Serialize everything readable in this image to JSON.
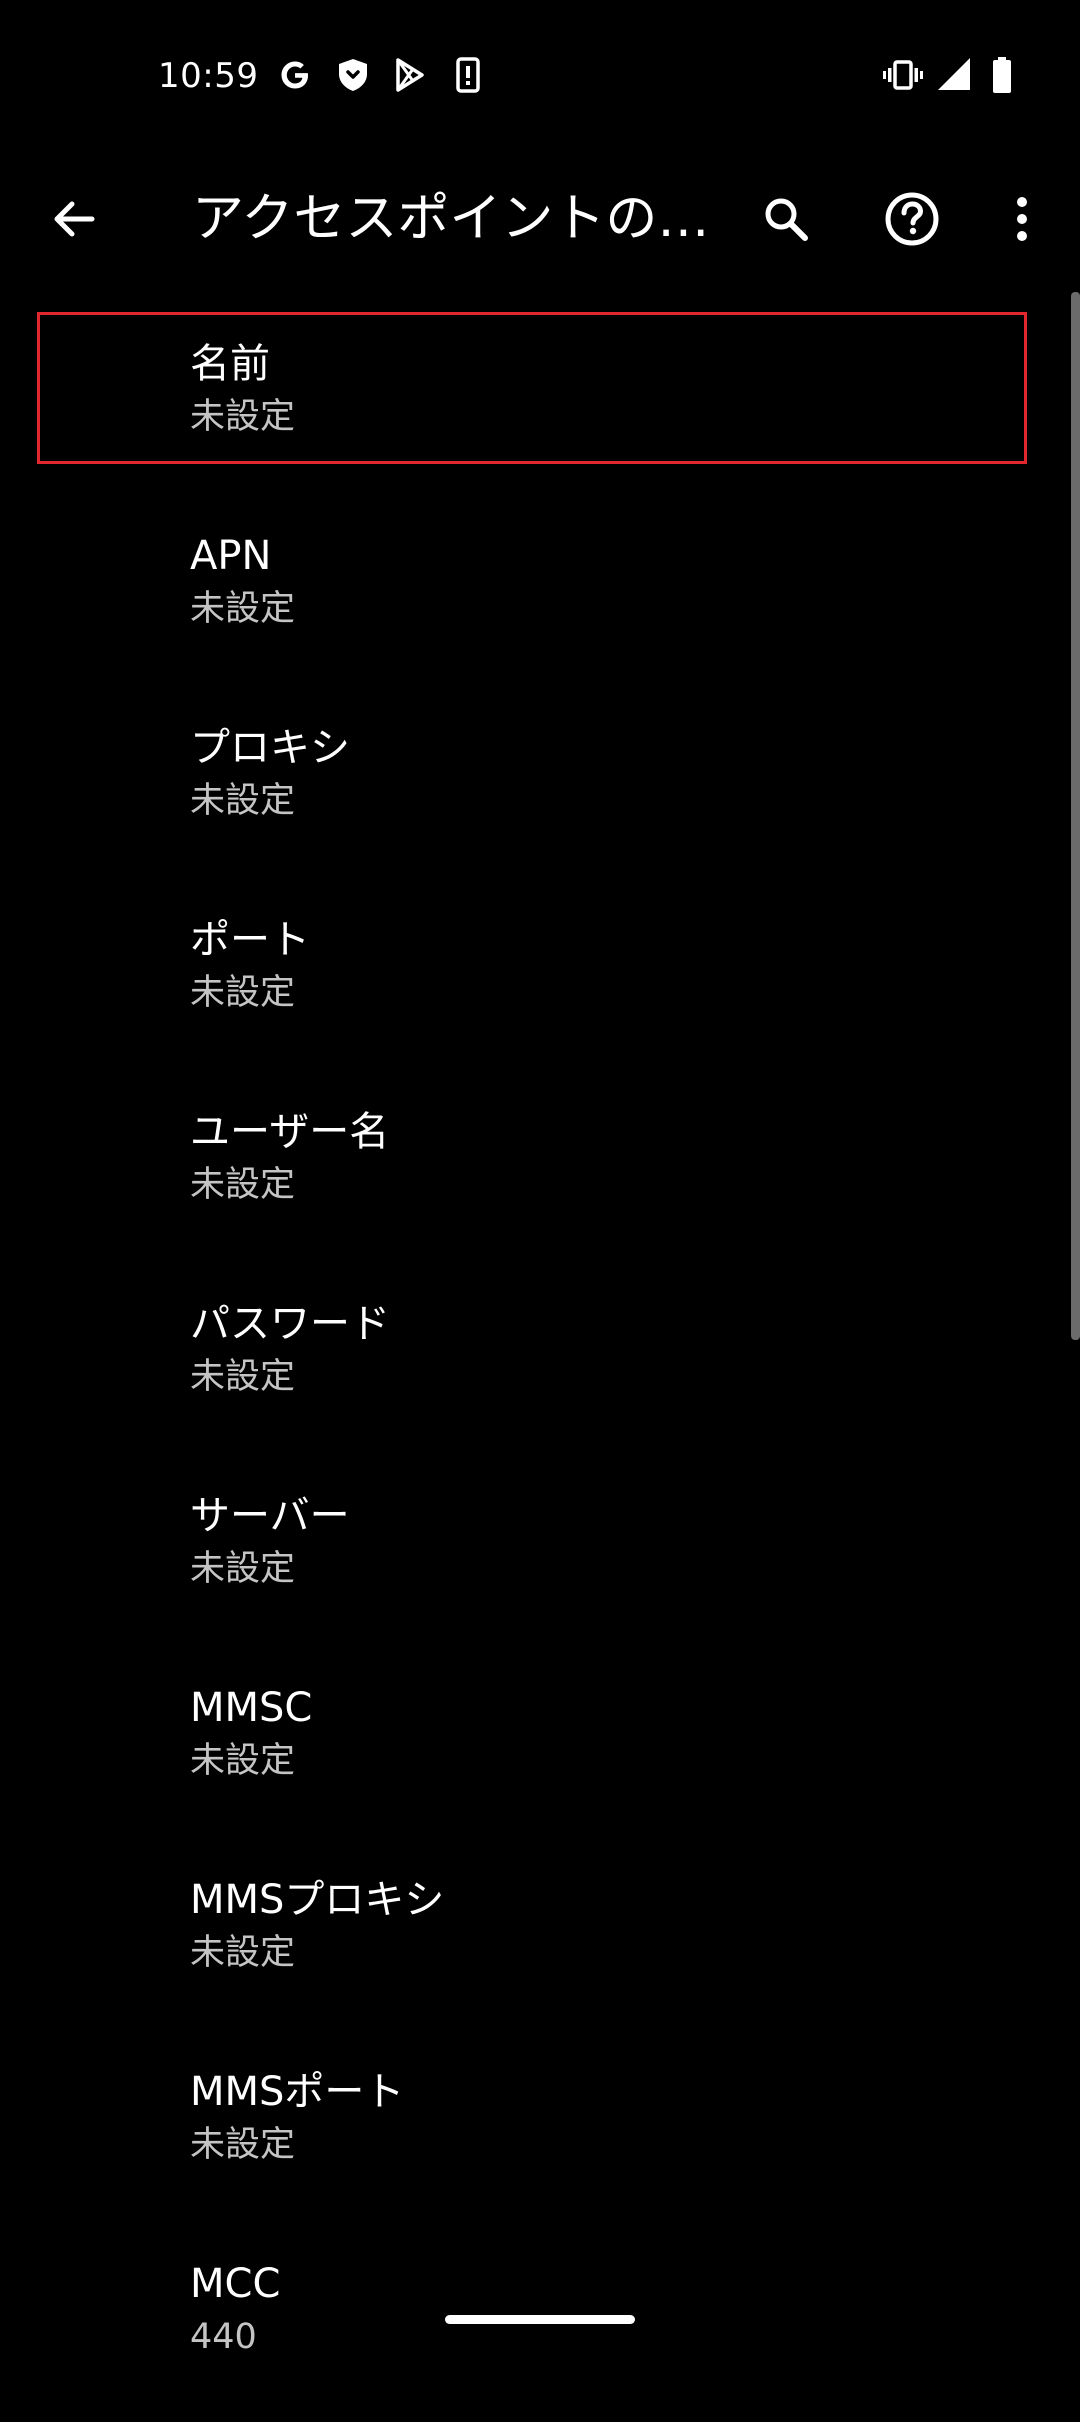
{
  "status_bar": {
    "time": "10:59",
    "icons": [
      "google-icon",
      "shield-icon",
      "play-store-icon",
      "phone-alert-icon",
      "vibrate-icon",
      "signal-icon",
      "battery-icon"
    ]
  },
  "app_bar": {
    "title": "アクセスポイントの編集",
    "icons": [
      "back-arrow-icon",
      "search-icon",
      "help-icon",
      "more-vert-icon"
    ]
  },
  "preferences": [
    {
      "title": "名前",
      "summary": "未設定"
    },
    {
      "title": "APN",
      "summary": "未設定"
    },
    {
      "title": "プロキシ",
      "summary": "未設定"
    },
    {
      "title": "ポート",
      "summary": "未設定"
    },
    {
      "title": "ユーザー名",
      "summary": "未設定"
    },
    {
      "title": "パスワード",
      "summary": "未設定"
    },
    {
      "title": "サーバー",
      "summary": "未設定"
    },
    {
      "title": "MMSC",
      "summary": "未設定"
    },
    {
      "title": "MMSプロキシ",
      "summary": "未設定"
    },
    {
      "title": "MMSポート",
      "summary": "未設定"
    },
    {
      "title": "MCC",
      "summary": "440"
    }
  ],
  "colors": {
    "background": "#000000",
    "text_primary": "#ffffff",
    "text_secondary": "#c4c4c4",
    "highlight": "#e2262e"
  }
}
